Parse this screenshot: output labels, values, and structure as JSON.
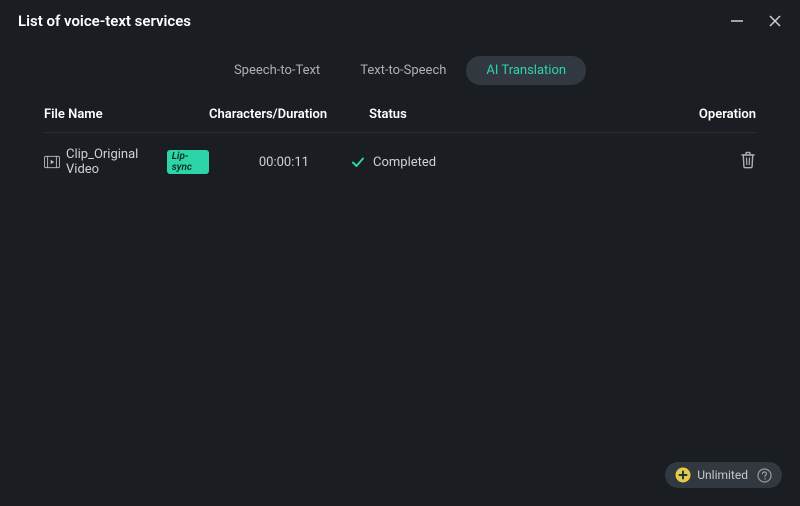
{
  "window": {
    "title": "List of voice-text services"
  },
  "tabs": [
    {
      "label": "Speech-to-Text",
      "active": false
    },
    {
      "label": "Text-to-Speech",
      "active": false
    },
    {
      "label": "AI Translation",
      "active": true
    }
  ],
  "columns": {
    "filename": "File Name",
    "chars_duration": "Characters/Duration",
    "status": "Status",
    "operation": "Operation"
  },
  "rows": [
    {
      "filename": "Clip_Original Video",
      "badge": "Lip-sync",
      "duration": "00:00:11",
      "status": "Completed"
    }
  ],
  "footer": {
    "unlimited": "Unlimited"
  }
}
